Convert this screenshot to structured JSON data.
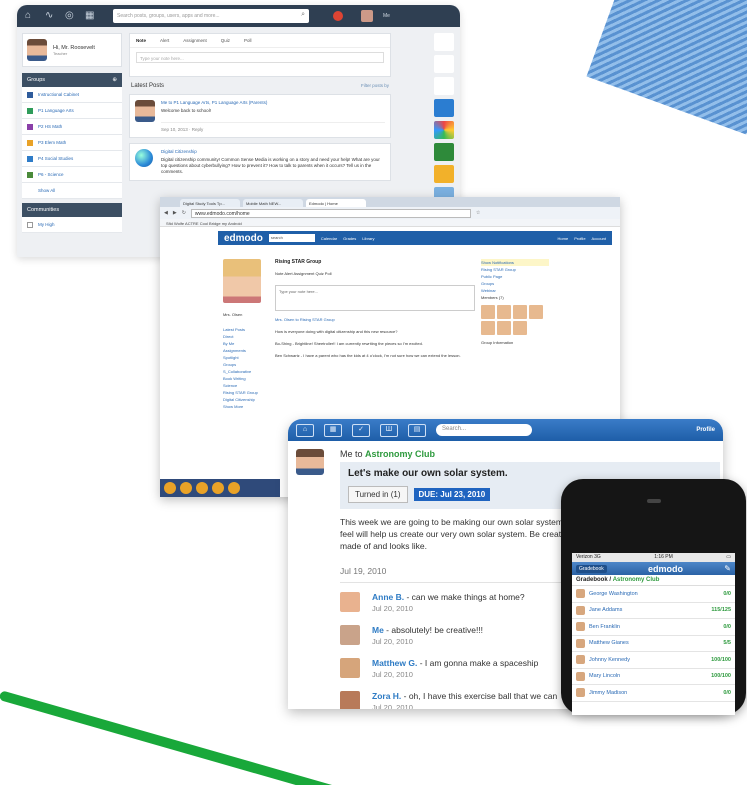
{
  "panel_a": {
    "search_placeholder": "Search posts, groups, users, apps and more...",
    "me_label": "Me",
    "profile": {
      "name": "Hi, Mr. Roosevelt",
      "role": "Teacher"
    },
    "groups_header": "Groups",
    "groups": [
      {
        "label": "Instructional Cabinet",
        "color": "#2f5c9c"
      },
      {
        "label": "P1 Language Arts",
        "color": "#2f9c5a"
      },
      {
        "label": "P2 HS Math",
        "color": "#8a3fa8"
      },
      {
        "label": "P3 Elem Math",
        "color": "#e9a227"
      },
      {
        "label": "P4 Social Studies",
        "color": "#2f7cc8"
      },
      {
        "label": "P6 - Science",
        "color": "#4a8a3a"
      },
      {
        "label": "Show All",
        "color": "#ffffff"
      }
    ],
    "communities_header": "Communities",
    "communities": [
      "My High"
    ],
    "composer_tabs": [
      "Note",
      "Alert",
      "Assignment",
      "Quiz",
      "Poll"
    ],
    "note_placeholder": "Type your note here...",
    "latest_posts": "Latest Posts",
    "filter": "Filter posts by",
    "post1": {
      "who": "Me to P1 Language Arts, P1 Language Arts (Parents)",
      "text": "Welcome back to school!",
      "meta": "Sep 10, 2013 · Reply"
    },
    "post2": {
      "who": "Digital Citizenship",
      "text": "Digital citizenship community! Common Sense Media is working on a story and need your help! What are your top questions about cyberbullying? How to prevent it? How to talk to parents when it occurs? Tell us in the comments."
    }
  },
  "panel_b": {
    "tabs": [
      "Digital Study Tools Tp...",
      "Mobile Math NEW...",
      "Edmodo | Home"
    ],
    "url": "www.edmodo.com/home",
    "bookmarks": "Sfid   Wolfe ACTRE Cool   Bridge my Android",
    "logo": "edmodo",
    "search_value": "search",
    "nav_links": [
      "Calendar",
      "Grades",
      "Library",
      "Home",
      "Profile",
      "Account"
    ],
    "name": "Mrs. Olsen",
    "left_nav": [
      "Latest Posts",
      "Direct",
      "By Me",
      "Assignments",
      "Spotlight",
      "Groups",
      "S_Collaborative",
      "Book Writing",
      "Science",
      "Rising STAR Group",
      "Digital Citizenship",
      "Show More"
    ],
    "header": "Rising STAR Group",
    "note_placeholder": "Type your note here...",
    "compose_tabs": "Note   Alert   Assignment   Quiz   Poll",
    "feed_line1": "Mrs. Olsen to Rising STAR Group",
    "feed_line2": "How is everyone doing with digital citizenship and this new resource?",
    "reply1": "Bo-Shing - Brightline! Sheetroller!! I am currently rewriting the pieces so I'm excited.",
    "reply2": "Ben Schwartz - I have a parent who has the kids at 4 o'clock, I'm not sure how we can extend the lesson.",
    "right_col": [
      "Show Notifications",
      "Rising STAR Group",
      "Public Page",
      "Groups",
      "Webinar",
      "Members (7)",
      "Group Information"
    ]
  },
  "panel_c": {
    "search_placeholder": "Search...",
    "profile_label": "Profile",
    "who_prefix": "Me",
    "to_word": " to ",
    "group": "Astronomy Club",
    "title": "Let's make our own solar system.",
    "turned_in": "Turned in (1)",
    "due": "DUE: Jul 23, 2010",
    "description": "This week we are going to be making our own solar system. Please bring items from home that you feel will help us create our very own solar system. Be creative! Think about what our solar system is made of and looks like.",
    "date": "Jul 19, 2010",
    "replies": [
      {
        "name": "Anne B.",
        "text": " - can we make things at home?",
        "date": "Jul 20, 2010",
        "color": "#e9b28f"
      },
      {
        "name": "Me",
        "text": " - absolutely! be creative!!!",
        "date": "Jul 20, 2010",
        "color": "#c9a38a"
      },
      {
        "name": "Matthew G.",
        "text": " - I am gonna make a spaceship",
        "date": "Jul 20, 2010",
        "color": "#d6a57b"
      },
      {
        "name": "Zora H.",
        "text": " - oh, I have this exercise ball that we can",
        "date": "Jul 20, 2010",
        "color": "#b87a5a"
      }
    ]
  },
  "phone": {
    "carrier": "Verizon 3G",
    "time": "1:16 PM",
    "gradebook": "Gradebook",
    "logo": "edmodo",
    "header_prefix": "Gradebook / ",
    "header_group": "Astronomy Club",
    "rows": [
      {
        "name": "George Washington",
        "score": "0/0"
      },
      {
        "name": "Jane Addams",
        "score": "115/125"
      },
      {
        "name": "Ben Franklin",
        "score": "0/0"
      },
      {
        "name": "Matthew Gianes",
        "score": "5/5"
      },
      {
        "name": "Johnny Kennedy",
        "score": "100/100"
      },
      {
        "name": "Mary Lincoln",
        "score": "100/100"
      },
      {
        "name": "Jimmy Madison",
        "score": "0/0"
      }
    ]
  }
}
